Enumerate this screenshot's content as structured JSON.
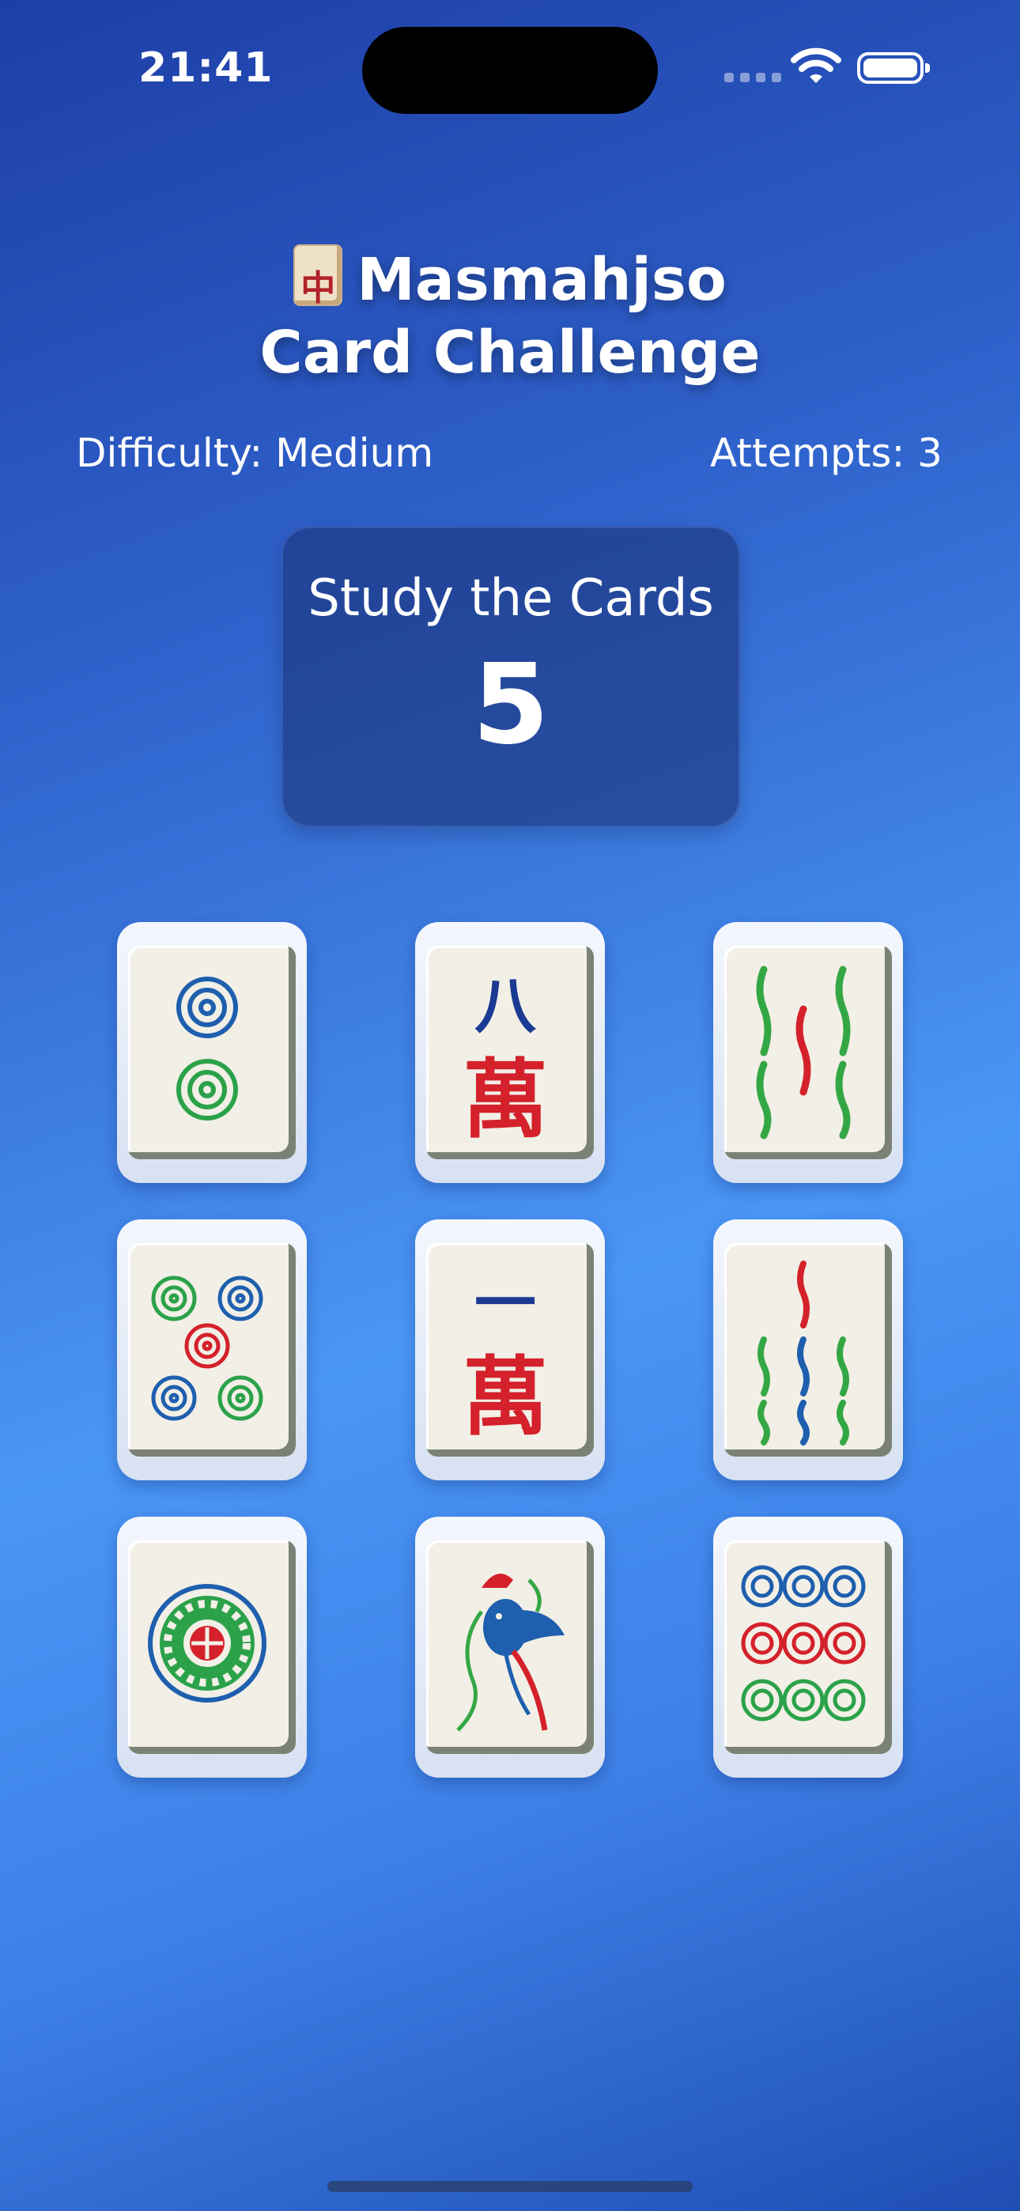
{
  "status_bar": {
    "time": "21:41"
  },
  "header": {
    "title_line1": "Masmahjso",
    "title_line2": "Card Challenge"
  },
  "info": {
    "difficulty": "Difficulty: Medium",
    "attempts": "Attempts: 3"
  },
  "timer": {
    "label": "Study the Cards",
    "value": "5"
  },
  "tiles": [
    {
      "name": "two-of-circles"
    },
    {
      "name": "eight-of-characters",
      "top": "八",
      "bottom": "萬"
    },
    {
      "name": "five-of-bamboo"
    },
    {
      "name": "five-of-circles"
    },
    {
      "name": "one-of-characters",
      "top": "一",
      "bottom": "萬"
    },
    {
      "name": "seven-of-bamboo"
    },
    {
      "name": "one-of-circles"
    },
    {
      "name": "one-of-bamboo-bird"
    },
    {
      "name": "nine-of-circles"
    }
  ],
  "colors": {
    "circle_blue": "#1e5fae",
    "circle_green": "#2ba24a",
    "circle_red": "#d4212b",
    "bamboo_green": "#34a745"
  }
}
